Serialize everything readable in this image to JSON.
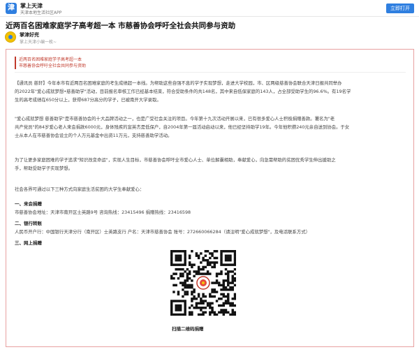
{
  "app": {
    "logo_glyph": "津",
    "name": "掌上天津",
    "subtitle": "天津本地生活社区APP",
    "open_button": "立即打开",
    "accent_color": "#2f7fe0"
  },
  "article": {
    "title": "近两百名困难家庭学子高考超一本 市慈善协会呼吁全社会共同参与资助",
    "author": "掌津好兜",
    "author_meta": "掌上天津小编一枚~",
    "intro": [
      "近两百名困难家庭学子高考超一本",
      "市慈善协会呼吁全社会共同参与资助"
    ],
    "paragraphs": [
      [
        "【通讯员 慈轩】今年本市有近两百名困难家庭的考生成绩超一本线。为帮助这些自强不息的学子实现梦想，走进大学校园，市、区两级慈善协会联合天津日报共同举办",
        "的2022年\"爱心成就梦想•慈善助学\"活动，目前报名审核工作已经基本结束，符合受助条件的共148名，其中来自低保家庭的143人，占全部受助学生的96.6%。有19名学",
        "生的高考成绩在650分以上，获得687分高分的学子，已被南开大学录取。"
      ],
      [
        "\"爱心成就梦想 慈善助学\"是市慈善协会的十大品牌活动之一，也是广受社会关注的项目。今年第十九次活动开展以来，已有很多爱心人士积极捐赠善款。署名为\"老",
        "共产党员\"的84岁爱心老人来会捐款6000元，身体残疾的宣英杰是低保户，自2004年第一届活动启动以来，他已经坚持助学19年。今年他积攒240元亲自送到协会。于女",
        "士从本人在市慈善协会设立的个人万元基金中出资11万元，支持慈善助学活动。"
      ],
      [
        "为了让更多家庭困难的学子追求\"知识改变命运\"，实现人生目标，市慈善协会呼吁全市爱心人士、单位解囊相助，奉献爱心，向急需帮助的贫困优秀学生伸出援助之",
        "手，帮助受助学子实现梦想。"
      ],
      [
        "社会各界可通过以下三种方式向家庭生活贫困的大学生奉献爱心："
      ]
    ],
    "sections": [
      {
        "heading": "一、来会捐赠",
        "detail": "市慈善协会地址：天津市南开区士英路9号 咨询热线：23415496 捐赠热线：23416598"
      },
      {
        "heading": "二、银行转账",
        "detail": "人民币开户行：中国银行天津分行（南开区）士英路支行 户名：天津市慈善协会 账号：272660066284（请注明\"爱心成就梦想\"，及电话联系方式）"
      },
      {
        "heading": "三、网上捐赠",
        "detail": ""
      }
    ],
    "qr_caption": "扫描二维码捐赠",
    "highlight_color": "#c0392b"
  }
}
